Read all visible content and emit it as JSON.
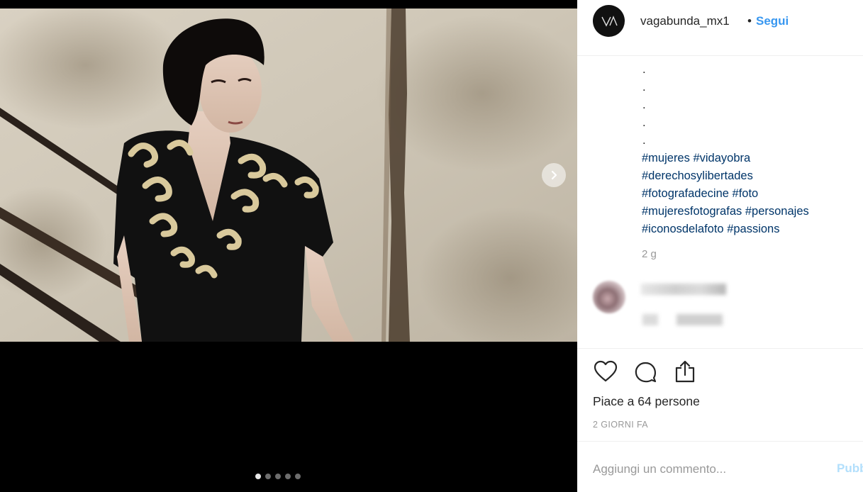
{
  "post": {
    "username": "vagabunda_mx1",
    "separator": "•",
    "follow_label": "Segui",
    "avatar_logo": "V/\\",
    "caption_dots": [
      ".",
      ".",
      ".",
      ".",
      "."
    ],
    "hashtag_lines": [
      [
        "#mujeres",
        "#vidayobra"
      ],
      [
        "#derechosylibertades"
      ],
      [
        "#fotografadecine",
        "#foto"
      ],
      [
        "#mujeresfotografas",
        "#personajes"
      ],
      [
        "#iconosdelafoto",
        "#passions"
      ]
    ],
    "age": "2 g",
    "likes_text": "Piace a 64 persone",
    "date": "2 GIORNI FA",
    "comment_placeholder": "Aggiungi un commento...",
    "publish_label": "Pubblica"
  },
  "media": {
    "slide_count": 5,
    "active_slide": 1
  },
  "icons": {
    "next": "chevron-right-icon",
    "like": "heart-icon",
    "comment": "comment-bubble-icon",
    "share": "share-upload-icon"
  },
  "colors": {
    "link": "#3897f0",
    "hashtag": "#003569",
    "text": "#262626",
    "muted": "#999999"
  }
}
